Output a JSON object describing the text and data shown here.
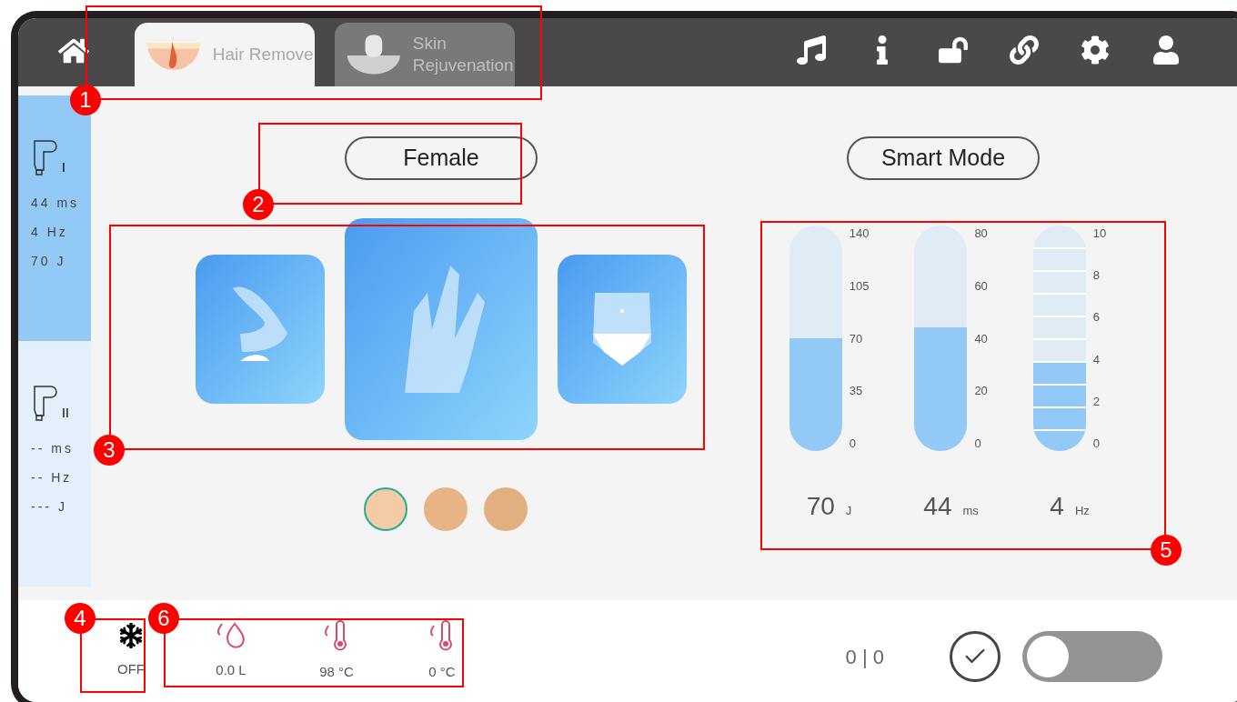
{
  "tabs": [
    {
      "label": "Hair Remove",
      "kind": "hair",
      "selected": true
    },
    {
      "label": "Skin Rejuvenation",
      "kind": "skin",
      "selected": false
    }
  ],
  "toolbar": [
    {
      "kind": "music"
    },
    {
      "kind": "info"
    },
    {
      "kind": "unlock"
    },
    {
      "kind": "link"
    },
    {
      "kind": "settings"
    },
    {
      "kind": "user"
    }
  ],
  "handpieces": [
    {
      "label": "I",
      "selected": true,
      "readings": [
        "44 ms",
        "4 Hz",
        "70 J"
      ]
    },
    {
      "label": "II",
      "selected": false,
      "readings": [
        "-- ms",
        "-- Hz",
        "--- J"
      ]
    }
  ],
  "gender": {
    "label": "Female"
  },
  "mode": {
    "label": "Smart Mode"
  },
  "body_areas": [
    {
      "kind": "arm",
      "selected": false
    },
    {
      "kind": "hand",
      "selected": true
    },
    {
      "kind": "bikini",
      "selected": false
    }
  ],
  "skin_tones": [
    {
      "color": "#f5cba6",
      "selected": true
    },
    {
      "color": "#e8b486",
      "selected": false
    },
    {
      "color": "#e2b080",
      "selected": false
    }
  ],
  "meters": [
    {
      "kind": "solid",
      "level": 0.5,
      "ticks": [
        "140",
        "105",
        "70",
        "35",
        "0"
      ],
      "value": "70",
      "unit": "J"
    },
    {
      "kind": "solid",
      "level": 0.55,
      "ticks": [
        "80",
        "60",
        "40",
        "20",
        "0"
      ],
      "value": "44",
      "unit": "ms"
    },
    {
      "kind": "segmented",
      "level": 0.4,
      "ticks": [
        "10",
        "8",
        "6",
        "4",
        "2",
        "0"
      ],
      "value": "4",
      "unit": "Hz"
    }
  ],
  "cooling": {
    "on": false,
    "label": "OFF"
  },
  "status": [
    {
      "kind": "water",
      "value": "0.0 L"
    },
    {
      "kind": "temperature",
      "value": "98 °C"
    },
    {
      "kind": "temperature",
      "value": "0 °C"
    }
  ],
  "counter": "0 | 0",
  "ready_switch": {
    "on": false
  },
  "annotations": [
    "1",
    "2",
    "3",
    "4",
    "5",
    "6"
  ]
}
